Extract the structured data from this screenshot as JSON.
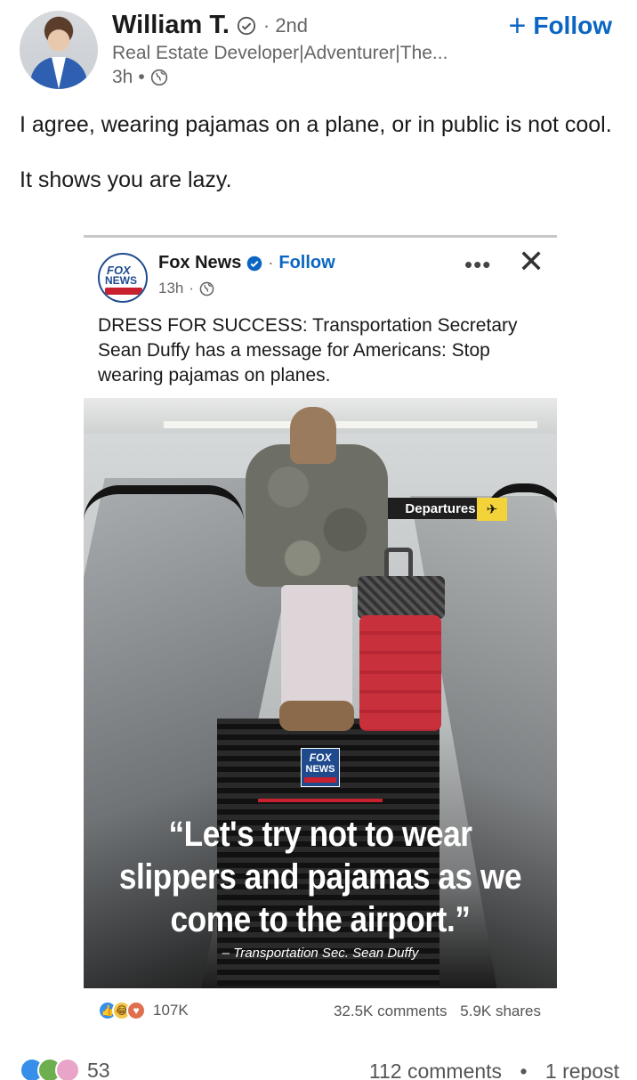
{
  "author": {
    "name": "William T.",
    "degree": "· 2nd",
    "headline": "Real Estate Developer|Adventurer|The...",
    "time": "3h",
    "visibility_icon": "globe-icon",
    "follow_label": "Follow",
    "follow_icon": "plus-icon"
  },
  "post": {
    "paragraphs": [
      "I agree, wearing pajamas on a plane, or in public is not cool.",
      "It shows you are lazy."
    ]
  },
  "shared": {
    "name": "Fox News",
    "follow_label": "Follow",
    "time": "13h",
    "visibility_icon": "globe-icon",
    "text": "DRESS FOR SUCCESS: Transportation Secretary Sean Duffy has a message for Americans: Stop wearing pajamas on planes.",
    "logo": {
      "line1": "FOX",
      "line2": "NEWS"
    },
    "image": {
      "sign_text": "Departures",
      "quote": "“Let's try not to wear slippers and pajamas as we come to the airport.”",
      "attribution": "– Transportation Sec. Sean Duffy",
      "logo_line1": "FOX",
      "logo_line2": "NEWS"
    },
    "reactions_count": "107K",
    "comments": "32.5K comments",
    "shares": "5.9K shares"
  },
  "social": {
    "reactions_count": "53",
    "comments": "112 comments",
    "separator": "•",
    "reposts": "1 repost"
  },
  "colors": {
    "accent": "#0a66c2",
    "fox_blue": "#1f4b8e",
    "fox_red": "#c8202f"
  }
}
